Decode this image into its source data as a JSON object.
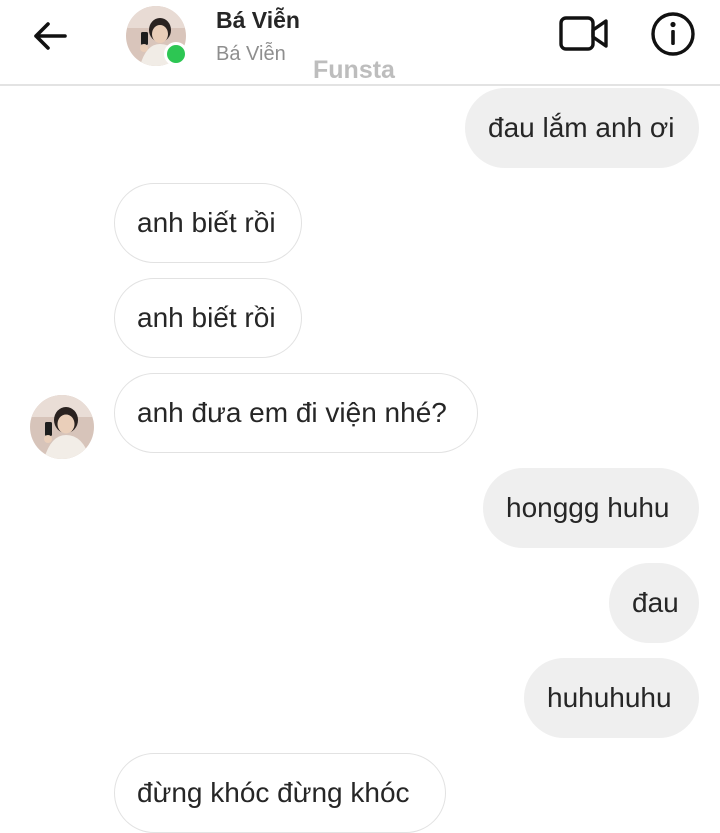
{
  "header": {
    "back_icon": "arrow-left-icon",
    "contact_name": "Bá Viễn",
    "contact_username": "Bá Viễn",
    "online_status_color": "#2dc653",
    "watermark": "Funsta",
    "video_icon": "video-camera-icon",
    "info_icon": "info-circle-icon"
  },
  "messages": [
    {
      "side": "sent",
      "text": "đau lắm anh ơi"
    },
    {
      "side": "received",
      "text": "anh biết rồi"
    },
    {
      "side": "received",
      "text": "anh biết rồi"
    },
    {
      "side": "received",
      "text": "anh đưa em đi viện nhé?",
      "show_avatar": true
    },
    {
      "side": "sent",
      "text": "honggg huhu"
    },
    {
      "side": "sent",
      "text": "đau"
    },
    {
      "side": "sent",
      "text": "huhuhuhu"
    },
    {
      "side": "received",
      "text": "đừng khóc đừng khóc"
    }
  ],
  "colors": {
    "sent_bubble": "#efefef",
    "received_bubble_border": "#e2e2e2",
    "text": "#262626",
    "secondary_text": "#8e8e8e"
  }
}
